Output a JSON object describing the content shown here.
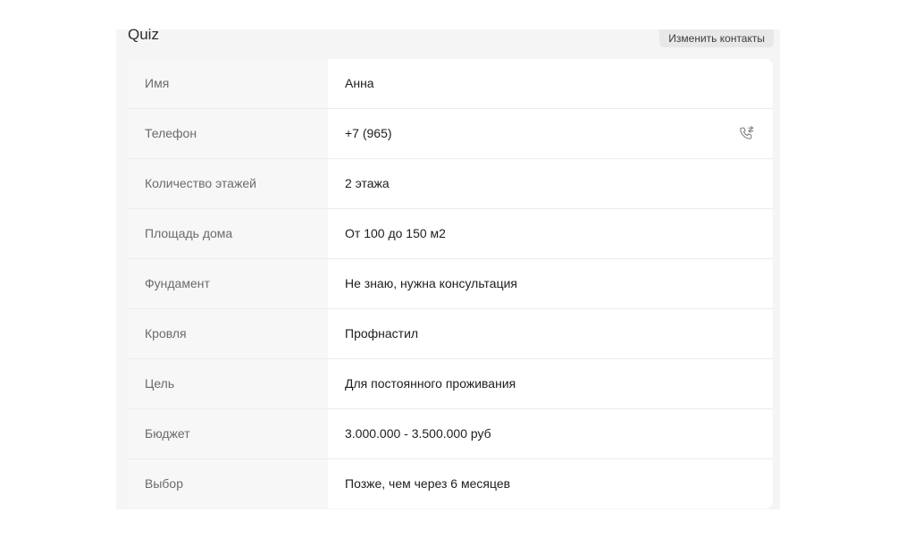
{
  "panel": {
    "title": "Quiz",
    "edit_button_label": "Изменить контакты"
  },
  "rows": [
    {
      "label": "Имя",
      "value": "Анна"
    },
    {
      "label": "Телефон",
      "value": "+7 (965)"
    },
    {
      "label": "Количество этажей",
      "value": "2 этажа"
    },
    {
      "label": "Площадь дома",
      "value": "От 100 до 150 м2"
    },
    {
      "label": "Фундамент",
      "value": "Не знаю, нужна консультация"
    },
    {
      "label": "Кровля",
      "value": "Профнастил"
    },
    {
      "label": "Цель",
      "value": "Для постоянного проживания"
    },
    {
      "label": "Бюджет",
      "value": "3.000.000 - 3.500.000 руб"
    },
    {
      "label": "Выбор",
      "value": "Позже, чем через 6 месяцев"
    }
  ],
  "icons": {
    "phone_row_action": "phone-call-icon"
  }
}
